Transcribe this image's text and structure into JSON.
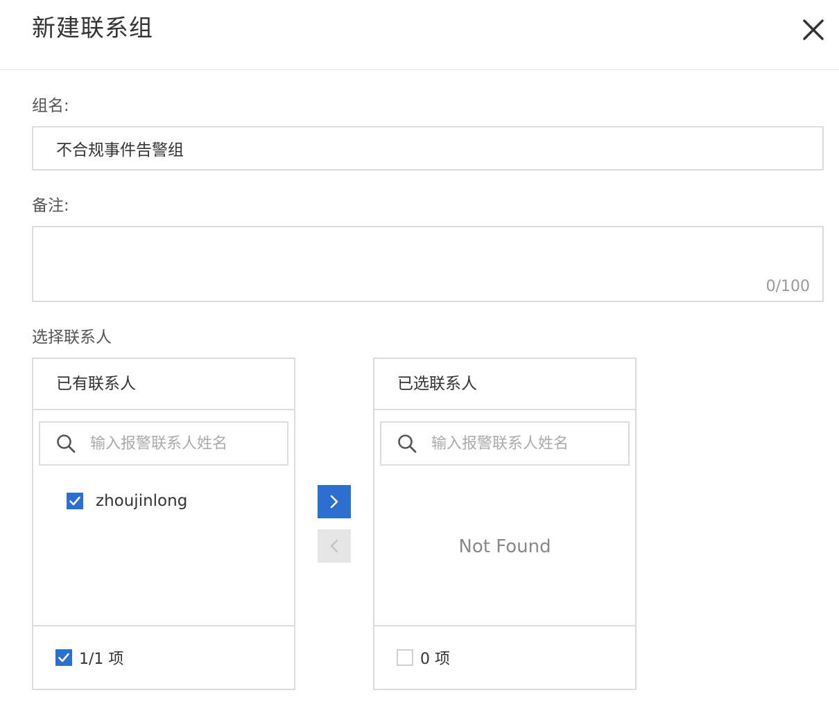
{
  "dialog": {
    "title": "新建联系组"
  },
  "form": {
    "group_name_label": "组名:",
    "group_name_value": "不合规事件告警组",
    "remark_label": "备注:",
    "remark_value": "",
    "remark_counter": "0/100",
    "contacts_label": "选择联系人"
  },
  "transfer": {
    "source": {
      "title": "已有联系人",
      "search_placeholder": "输入报警联系人姓名",
      "items": [
        {
          "label": "zhoujinlong",
          "checked": true
        }
      ],
      "footer": "1/1 项",
      "footer_checked": true
    },
    "target": {
      "title": "已选联系人",
      "search_placeholder": "输入报警联系人姓名",
      "empty_text": "Not Found",
      "footer": "0 项",
      "footer_checked": false
    },
    "buttons": {
      "to_right_icon": "chevron-right-icon",
      "to_left_icon": "chevron-left-icon",
      "to_right_enabled": true,
      "to_left_enabled": false
    }
  },
  "colors": {
    "accent": "#2d6fcf",
    "border": "#dcdcdc",
    "disabled": "#e6e6e6",
    "muted_text": "#888888"
  }
}
